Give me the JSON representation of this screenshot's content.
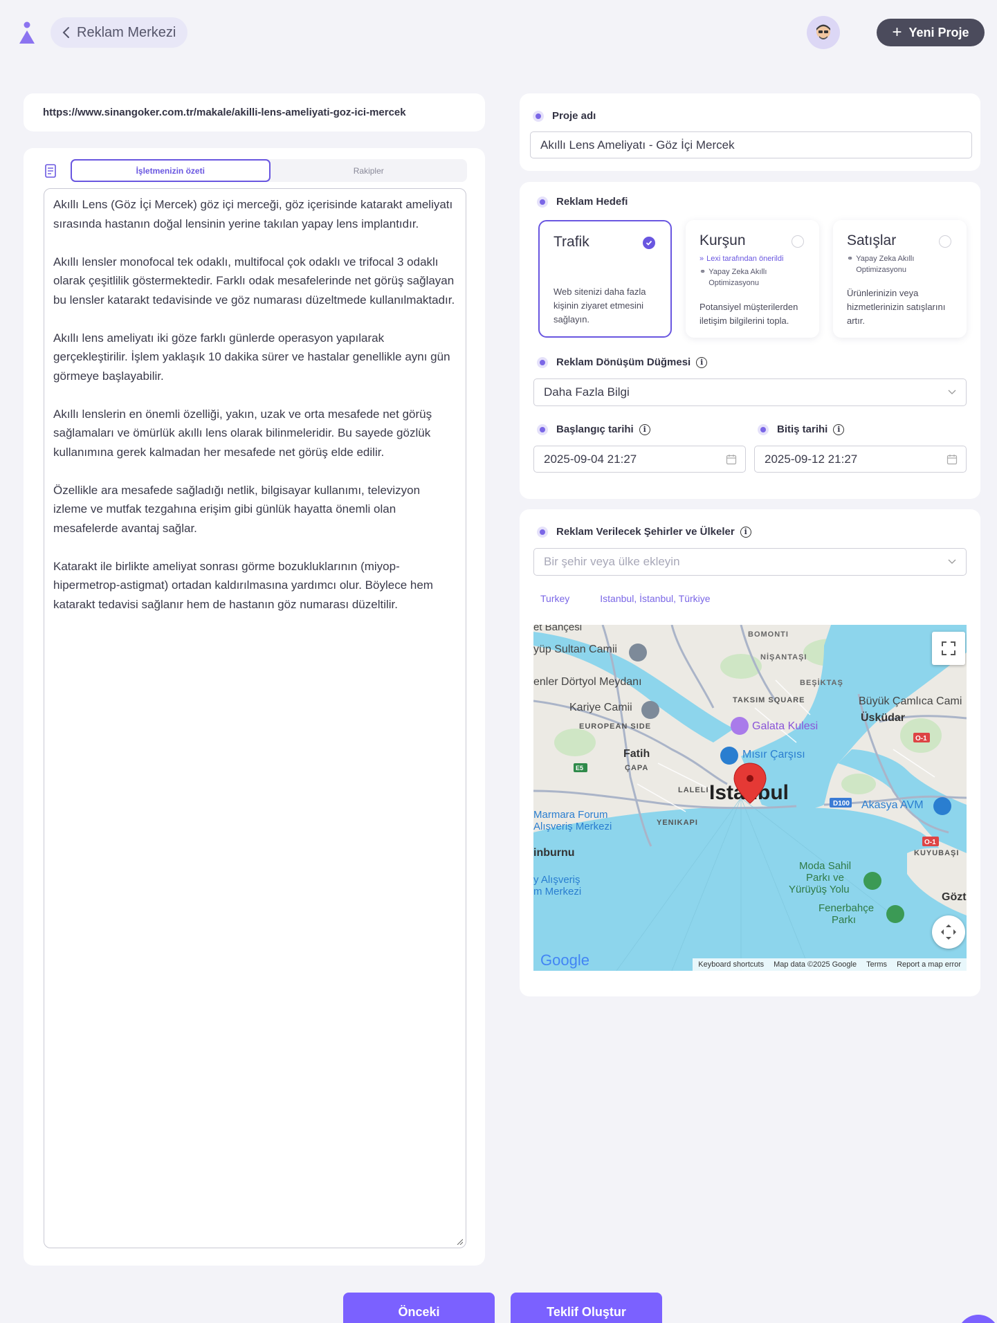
{
  "header": {
    "back_label": "Reklam Merkezi",
    "new_project_label": "Yeni Proje"
  },
  "url": "https://www.sinangoker.com.tr/makale/akilli-lens-ameliyati-goz-ici-mercek",
  "summary": {
    "tabs": [
      {
        "label": "İşletmenizin özeti",
        "active": true
      },
      {
        "label": "Rakipler",
        "active": false
      }
    ],
    "text": "Akıllı Lens (Göz İçi Mercek) göz içi merceği, göz içerisinde katarakt ameliyatı sırasında hastanın doğal lensinin yerine takılan yapay lens implantıdır.\n\nAkıllı lensler monofocal tek odaklı, multifocal çok odaklı ve trifocal 3 odaklı olarak çeşitlilik göstermektedir. Farklı odak mesafelerinde net görüş sağlayan bu lensler katarakt tedavisinde ve göz numarası düzeltmede kullanılmaktadır.\n\nAkıllı lens ameliyatı iki göze farklı günlerde operasyon yapılarak gerçekleştirilir. İşlem yaklaşık 10 dakika sürer ve hastalar genellikle aynı gün görmeye başlayabilir.\n\nAkıllı lenslerin en önemli özelliği, yakın, uzak ve orta mesafede net görüş sağlamaları ve ömürlük akıllı lens olarak bilinmeleridir. Bu sayede gözlük kullanımına gerek kalmadan her mesafede net görüş elde edilir.\n\nÖzellikle ara mesafede sağladığı netlik, bilgisayar kullanımı, televizyon izleme ve mutfak tezgahına erişim gibi günlük hayatta önemli olan mesafelerde avantaj sağlar.\n\nKatarakt ile birlikte ameliyat sonrası görme bozukluklarının (miyop-hipermetrop-astigmat) ortadan kaldırılmasına yardımcı olur. Böylece hem katarakt tedavisi sağlanır hem de hastanın göz numarası düzeltilir."
  },
  "project": {
    "label": "Proje adı",
    "value": "Akıllı Lens Ameliyatı - Göz İçi Mercek"
  },
  "ad_goal": {
    "label": "Reklam Hedefi",
    "options": [
      {
        "title": "Trafik",
        "selected": true,
        "notes": [],
        "desc": "Web sitenizi daha fazla kişinin ziyaret etmesini sağlayın."
      },
      {
        "title": "Kurşun",
        "selected": false,
        "suggested": "Lexi tarafından önerildi",
        "notes": [
          "Yapay Zeka Akıllı Optimizasyonu"
        ],
        "desc": "Potansiyel müşterilerden iletişim bilgilerini topla."
      },
      {
        "title": "Satışlar",
        "selected": false,
        "notes": [
          "Yapay Zeka Akıllı Optimizasyonu"
        ],
        "desc": "Ürünlerinizin veya hizmetlerinizin satışlarını artır."
      }
    ]
  },
  "cta": {
    "label": "Reklam Dönüşüm Düğmesi",
    "value": "Daha Fazla Bilgi"
  },
  "dates": {
    "start_label": "Başlangıç tarihi",
    "start_value": "2025-09-04 21:27",
    "end_label": "Bitiş tarihi",
    "end_value": "2025-09-12 21:27"
  },
  "locations": {
    "label": "Reklam Verilecek Şehirler ve Ülkeler",
    "placeholder": "Bir şehir veya ülke ekleyin",
    "chips": [
      "Turkey",
      "Istanbul, İstanbul, Türkiye"
    ]
  },
  "map": {
    "labels": {
      "ayup": "yüp Sultan Camii",
      "bahcesi": "et Bahçesi",
      "bomonti": "BOMONTI",
      "nisantasi": "NİŞANTAŞI",
      "besiktas": "BEŞİKTAŞ",
      "dortyol": "enler Dörtyol Meydanı",
      "kariye": "Kariye Camii",
      "taksim": "TAKSIM SQUARE",
      "camlica": "Büyük Çamlıca Cami",
      "uskudar": "Üsküdar",
      "european": "EUROPEAN SIDE",
      "galata": "Galata Kulesi",
      "misir": "Mısır Çarşısı",
      "fatih": "Fatih",
      "capa": "ÇAPA",
      "laleli": "LALELI",
      "istanbul": "Istanbul",
      "akasya": "Akasya AVM",
      "marmara1": "Marmara Forum",
      "marmara2": "Alışveriş Merkezi",
      "yenikapi": "YENIKAPI",
      "inburnu": "inburnu",
      "alisveris1": "y Alışveriş",
      "alisveris2": "m Merkezi",
      "moda1": "Moda Sahil",
      "moda2": "Parkı ve",
      "moda3": "Yürüyüş Yolu",
      "kuyubasi": "KUYUBAŞI",
      "fener1": "Fenerbahçe",
      "fener2": "Parkı",
      "gozte": "Gözt",
      "d100": "D100",
      "o1a": "O-1",
      "o1b": "O-1",
      "e5": "E5"
    },
    "footer": [
      "Keyboard shortcuts",
      "Map data ©2025 Google",
      "Terms",
      "Report a map error"
    ],
    "google_logo": "Google"
  },
  "footer_buttons": {
    "prev": "Önceki",
    "next": "Teklif Oluştur"
  },
  "colors": {
    "accent": "#7b61ff",
    "accent_dark": "#6956e0",
    "dark_button": "#4b4b5c"
  }
}
